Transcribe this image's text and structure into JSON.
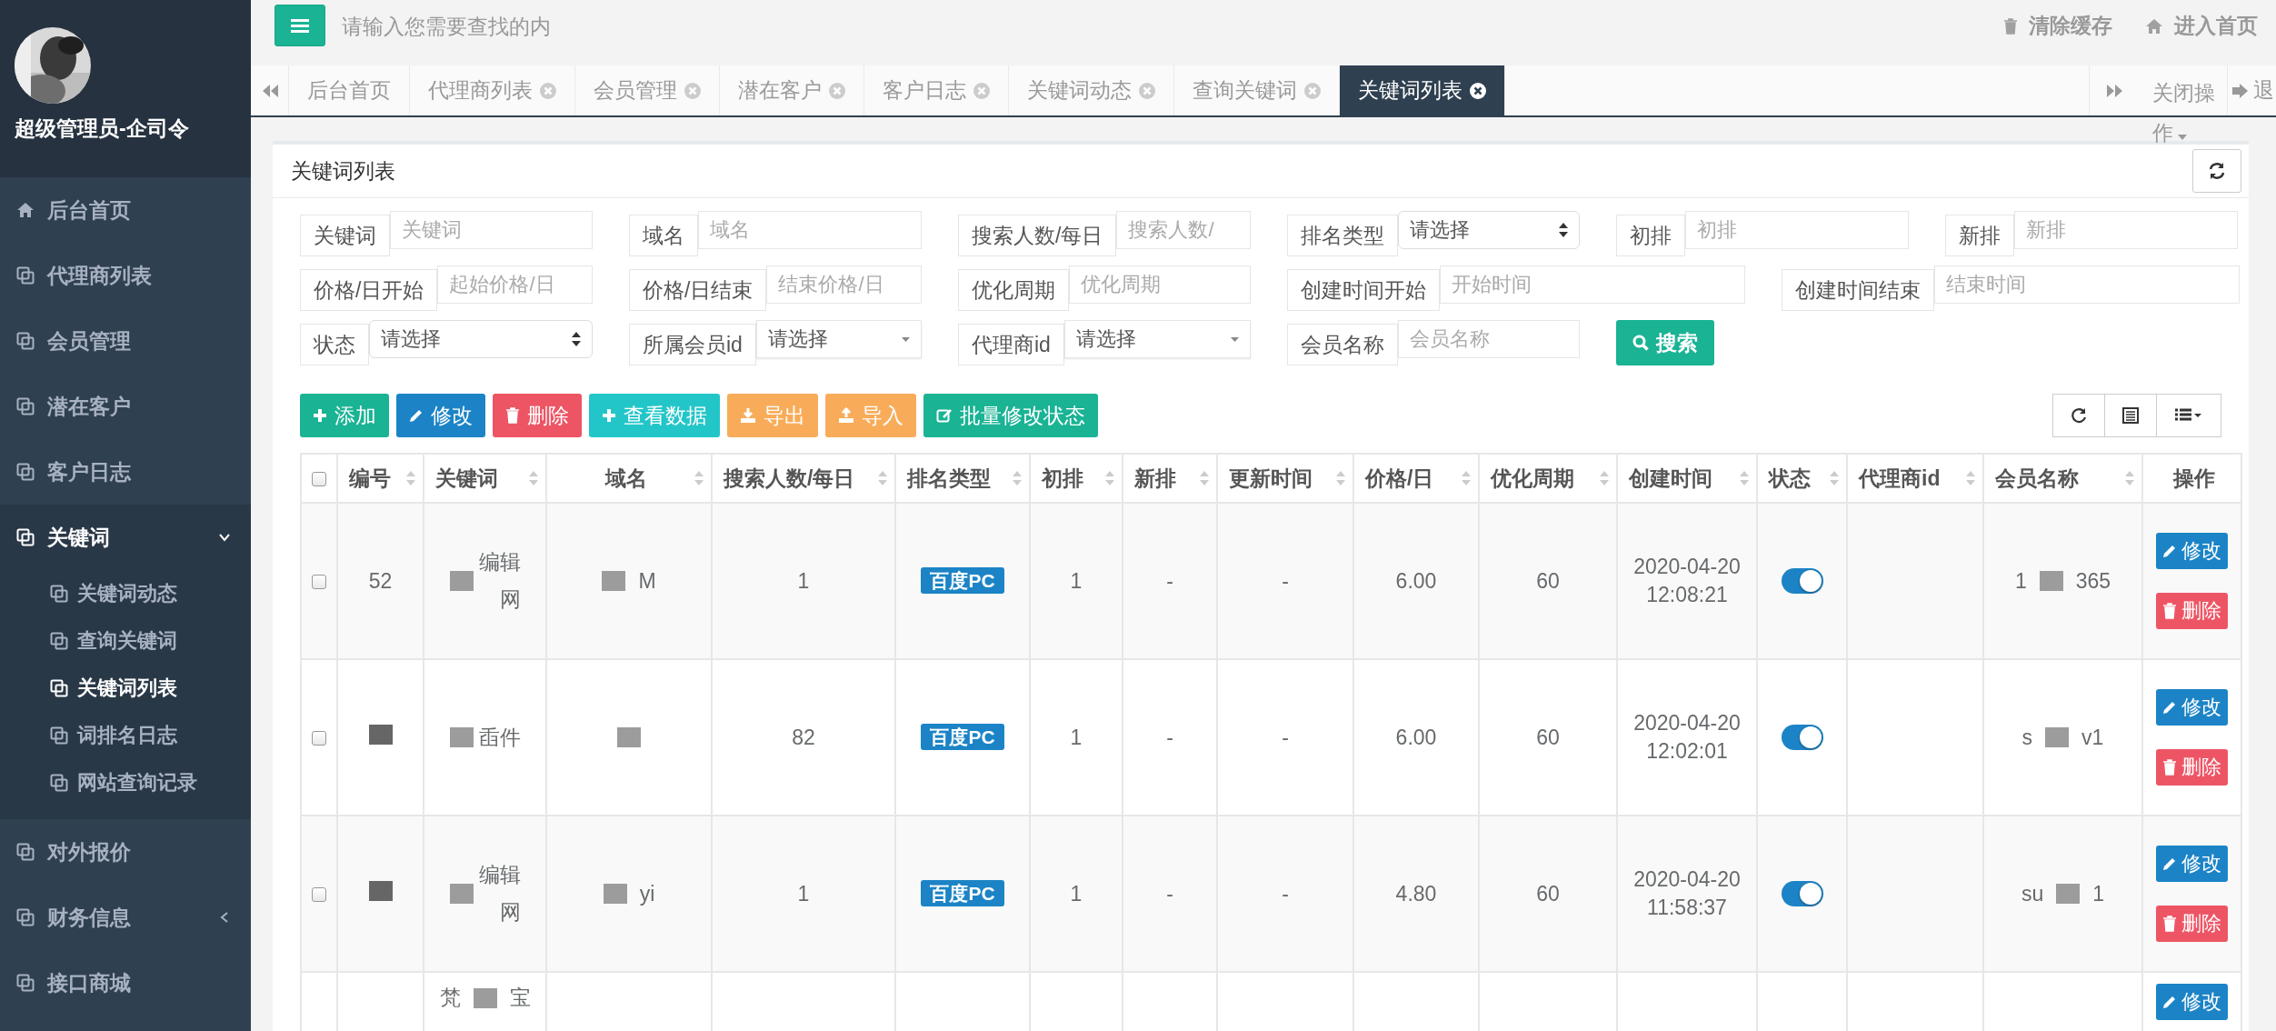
{
  "sidebar": {
    "user": {
      "name": "超级管理员-企司令"
    },
    "items": [
      {
        "label": "后台首页",
        "kind": "home",
        "selected": false
      },
      {
        "label": "代理商列表",
        "kind": "page",
        "selected": false
      },
      {
        "label": "会员管理",
        "kind": "page",
        "selected": false
      },
      {
        "label": "潜在客户",
        "kind": "page",
        "selected": false
      },
      {
        "label": "客户日志",
        "kind": "page",
        "selected": false
      },
      {
        "label": "关键词",
        "kind": "page",
        "selected": true,
        "expanded": true,
        "children": [
          {
            "label": "关键词动态",
            "selected": false
          },
          {
            "label": "查询关键词",
            "selected": false
          },
          {
            "label": "关键词列表",
            "selected": true
          },
          {
            "label": "词排名日志",
            "selected": false
          },
          {
            "label": "网站查询记录",
            "selected": false
          }
        ]
      },
      {
        "label": "对外报价",
        "kind": "page",
        "selected": false
      },
      {
        "label": "财务信息",
        "kind": "page",
        "selected": false,
        "expanded": false
      },
      {
        "label": "接口商城",
        "kind": "page",
        "selected": false
      }
    ]
  },
  "topbar": {
    "search": {
      "placeholder": "请输入您需要查找的内"
    },
    "links": [
      {
        "label": "清除缓存",
        "kind": "trash"
      },
      {
        "label": "进入首页",
        "kind": "home"
      }
    ]
  },
  "tabs": [
    {
      "label": "后台首页",
      "selected": false,
      "closable": false
    },
    {
      "label": "代理商列表",
      "selected": false,
      "closable": true
    },
    {
      "label": "会员管理",
      "selected": false,
      "closable": true
    },
    {
      "label": "潜在客户",
      "selected": false,
      "closable": true
    },
    {
      "label": "客户日志",
      "selected": false,
      "closable": true
    },
    {
      "label": "关键词动态",
      "selected": false,
      "closable": true
    },
    {
      "label": "查询关键词",
      "selected": false,
      "closable": true
    },
    {
      "label": "关键词列表",
      "selected": true,
      "closable": true
    }
  ],
  "tab_actions": {
    "close_menu": "关闭操作",
    "logout": "退"
  },
  "panel": {
    "title": "关键词列表",
    "filters": [
      [
        {
          "kind": "input",
          "label": "关键词",
          "placeholder": "关键词"
        },
        {
          "kind": "input",
          "label": "域名",
          "placeholder": "域名"
        },
        {
          "kind": "input",
          "label": "搜索人数/每日",
          "placeholder": "搜索人数/"
        },
        {
          "kind": "select",
          "label": "排名类型",
          "value": "请选择"
        },
        {
          "kind": "input",
          "label": "初排",
          "placeholder": "初排"
        },
        {
          "kind": "input",
          "label": "新排",
          "placeholder": "新排"
        }
      ],
      [
        {
          "kind": "input",
          "label": "价格/日开始",
          "placeholder": "起始价格/日"
        },
        {
          "kind": "input",
          "label": "价格/日结束",
          "placeholder": "结束价格/日"
        },
        {
          "kind": "input",
          "label": "优化周期",
          "placeholder": "优化周期"
        },
        {
          "kind": "input",
          "label": "创建时间开始",
          "placeholder": "开始时间"
        },
        {
          "kind": "input",
          "label": "创建时间结束",
          "placeholder": "结束时间"
        }
      ],
      [
        {
          "kind": "select",
          "label": "状态",
          "value": "请选择"
        },
        {
          "kind": "dropdown",
          "label": "所属会员id",
          "value": "请选择"
        },
        {
          "kind": "dropdown",
          "label": "代理商id",
          "value": "请选择"
        },
        {
          "kind": "input",
          "label": "会员名称",
          "placeholder": "会员名称"
        },
        {
          "kind": "button",
          "label": "搜索"
        }
      ]
    ],
    "toolbar": [
      {
        "kind": "add",
        "label": "添加"
      },
      {
        "kind": "edit",
        "label": "修改"
      },
      {
        "kind": "delete",
        "label": "删除"
      },
      {
        "kind": "view",
        "label": "查看数据"
      },
      {
        "kind": "export",
        "label": "导出"
      },
      {
        "kind": "import",
        "label": "导入"
      },
      {
        "kind": "batch",
        "label": "批量修改状态"
      }
    ],
    "table": {
      "select_all": {
        "checked": false
      },
      "columns": [
        {
          "label": "编号",
          "sortable": true
        },
        {
          "label": "关键词",
          "sortable": true
        },
        {
          "label": "域名",
          "sortable": true
        },
        {
          "label": "搜索人数/每日",
          "sortable": true
        },
        {
          "label": "排名类型",
          "sortable": true
        },
        {
          "label": "初排",
          "sortable": true
        },
        {
          "label": "新排",
          "sortable": true
        },
        {
          "label": "更新时间",
          "sortable": true
        },
        {
          "label": "价格/日",
          "sortable": true
        },
        {
          "label": "优化周期",
          "sortable": true
        },
        {
          "label": "创建时间",
          "sortable": true
        },
        {
          "label": "状态",
          "sortable": true
        },
        {
          "label": "代理商id",
          "sortable": true
        },
        {
          "label": "会员名称",
          "sortable": true
        },
        {
          "label": "操作",
          "sortable": false
        }
      ],
      "rows": [
        {
          "checked": false,
          "id": "52",
          "keyword": [
            "编辑",
            "网"
          ],
          "domain": [
            "M"
          ],
          "searches": "1",
          "rank_type": "百度PC",
          "initial": "1",
          "new": "-",
          "updated": "-",
          "price": "6.00",
          "period": "60",
          "created": [
            "2020-04-20",
            "12:08:21"
          ],
          "on": true,
          "member": [
            "1",
            "365"
          ],
          "actions": [
            {
              "kind": "edit",
              "label": "修改"
            },
            {
              "kind": "delete",
              "label": "删除"
            }
          ]
        },
        {
          "checked": false,
          "keyword": [
            "臿件"
          ],
          "domain": [],
          "searches": "82",
          "rank_type": "百度PC",
          "initial": "1",
          "new": "-",
          "updated": "-",
          "price": "6.00",
          "period": "60",
          "created": [
            "2020-04-20",
            "12:02:01"
          ],
          "on": true,
          "member": [
            "s",
            "v1"
          ],
          "actions": [
            {
              "kind": "edit",
              "label": "修改"
            },
            {
              "kind": "delete",
              "label": "删除"
            }
          ]
        },
        {
          "checked": false,
          "keyword": [
            "编辑",
            "网"
          ],
          "domain": [
            "yi"
          ],
          "searches": "1",
          "rank_type": "百度PC",
          "initial": "1",
          "new": "-",
          "updated": "-",
          "price": "4.80",
          "period": "60",
          "created": [
            "2020-04-20",
            "11:58:37"
          ],
          "on": true,
          "member": [
            "su",
            "1"
          ],
          "actions": [
            {
              "kind": "edit",
              "label": "修改"
            },
            {
              "kind": "delete",
              "label": "删除"
            }
          ]
        },
        {
          "keyword_inline": [
            "梵",
            "宝"
          ],
          "actions": [
            {
              "kind": "edit",
              "label": "修改"
            }
          ]
        }
      ]
    }
  }
}
